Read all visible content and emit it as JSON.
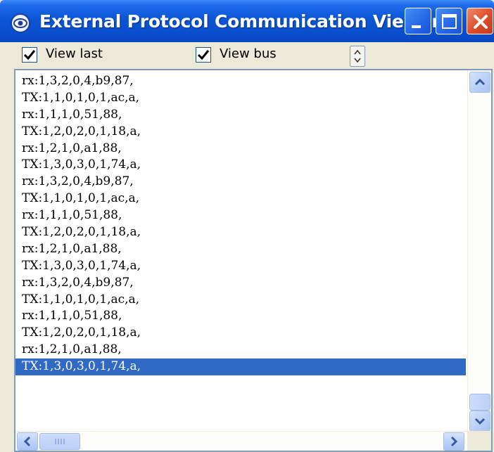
{
  "window": {
    "title": "External Protocol Communication Viewer",
    "icon": "eye-icon",
    "controls": {
      "minimize": "minimize-icon",
      "maximize": "maximize-icon",
      "close": "close-icon"
    }
  },
  "options": {
    "view_last": {
      "label": "View last",
      "checked": true
    },
    "view_bus": {
      "label": "View bus",
      "checked": true
    },
    "spinner_icon": "spinner-icon"
  },
  "log": {
    "lines": [
      "rx:1,3,2,0,4,b9,87,",
      "TX:1,1,0,1,0,1,ac,a,",
      "rx:1,1,1,0,51,88,",
      "TX:1,2,0,2,0,1,18,a,",
      "rx:1,2,1,0,a1,88,",
      "TX:1,3,0,3,0,1,74,a,",
      "rx:1,3,2,0,4,b9,87,",
      "TX:1,1,0,1,0,1,ac,a,",
      "rx:1,1,1,0,51,88,",
      "TX:1,2,0,2,0,1,18,a,",
      "rx:1,2,1,0,a1,88,",
      "TX:1,3,0,3,0,1,74,a,",
      "rx:1,3,2,0,4,b9,87,",
      "TX:1,1,0,1,0,1,ac,a,",
      "rx:1,1,1,0,51,88,",
      "TX:1,2,0,2,0,1,18,a,",
      "rx:1,2,1,0,a1,88,",
      "TX:1,3,0,3,0,1,74,a,"
    ],
    "selected_index": 17
  },
  "colors": {
    "titlebar": "#0a56d6",
    "selection": "#316ac5",
    "close_button": "#dd4c2a"
  }
}
